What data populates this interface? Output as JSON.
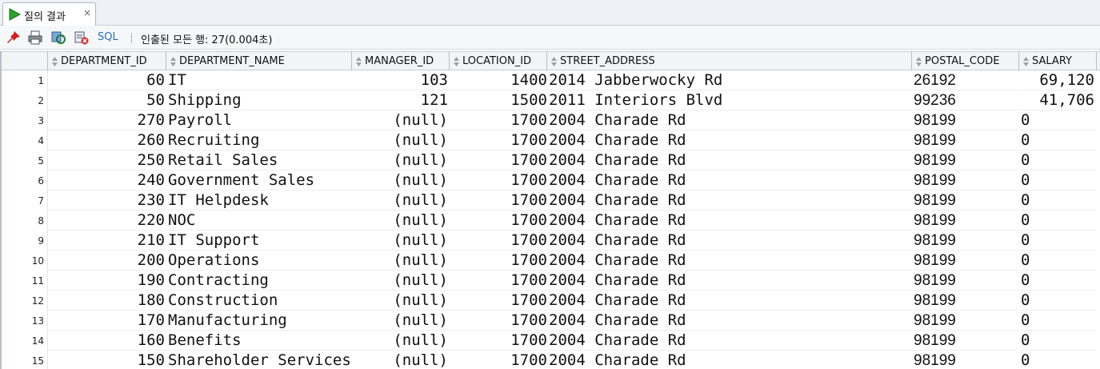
{
  "tab": {
    "title": "질의 결과",
    "close": "×"
  },
  "toolbar": {
    "icons": [
      "pin-icon",
      "print-icon",
      "refresh-icon",
      "cancel-query-icon"
    ],
    "sql_label": "SQL",
    "status": "인출된 모든 행: 27(0.004초)"
  },
  "columns": [
    "DEPARTMENT_ID",
    "DEPARTMENT_NAME",
    "MANAGER_ID",
    "LOCATION_ID",
    "STREET_ADDRESS",
    "POSTAL_CODE",
    "SALARY"
  ],
  "rows": [
    {
      "n": "1",
      "department_id": "60",
      "department_name": "IT",
      "manager_id": "103",
      "location_id": "1400",
      "street_address": "2014 Jabberwocky Rd",
      "postal_code": "26192",
      "salary": "69,120"
    },
    {
      "n": "2",
      "department_id": "50",
      "department_name": "Shipping",
      "manager_id": "121",
      "location_id": "1500",
      "street_address": "2011 Interiors Blvd",
      "postal_code": "99236",
      "salary": "41,706"
    },
    {
      "n": "3",
      "department_id": "270",
      "department_name": "Payroll",
      "manager_id": "(null)",
      "location_id": "1700",
      "street_address": "2004 Charade Rd",
      "postal_code": "98199",
      "salary": "0"
    },
    {
      "n": "4",
      "department_id": "260",
      "department_name": "Recruiting",
      "manager_id": "(null)",
      "location_id": "1700",
      "street_address": "2004 Charade Rd",
      "postal_code": "98199",
      "salary": "0"
    },
    {
      "n": "5",
      "department_id": "250",
      "department_name": "Retail Sales",
      "manager_id": "(null)",
      "location_id": "1700",
      "street_address": "2004 Charade Rd",
      "postal_code": "98199",
      "salary": "0"
    },
    {
      "n": "6",
      "department_id": "240",
      "department_name": "Government Sales",
      "manager_id": "(null)",
      "location_id": "1700",
      "street_address": "2004 Charade Rd",
      "postal_code": "98199",
      "salary": "0"
    },
    {
      "n": "7",
      "department_id": "230",
      "department_name": "IT Helpdesk",
      "manager_id": "(null)",
      "location_id": "1700",
      "street_address": "2004 Charade Rd",
      "postal_code": "98199",
      "salary": "0"
    },
    {
      "n": "8",
      "department_id": "220",
      "department_name": "NOC",
      "manager_id": "(null)",
      "location_id": "1700",
      "street_address": "2004 Charade Rd",
      "postal_code": "98199",
      "salary": "0"
    },
    {
      "n": "9",
      "department_id": "210",
      "department_name": "IT Support",
      "manager_id": "(null)",
      "location_id": "1700",
      "street_address": "2004 Charade Rd",
      "postal_code": "98199",
      "salary": "0"
    },
    {
      "n": "10",
      "department_id": "200",
      "department_name": "Operations",
      "manager_id": "(null)",
      "location_id": "1700",
      "street_address": "2004 Charade Rd",
      "postal_code": "98199",
      "salary": "0"
    },
    {
      "n": "11",
      "department_id": "190",
      "department_name": "Contracting",
      "manager_id": "(null)",
      "location_id": "1700",
      "street_address": "2004 Charade Rd",
      "postal_code": "98199",
      "salary": "0"
    },
    {
      "n": "12",
      "department_id": "180",
      "department_name": "Construction",
      "manager_id": "(null)",
      "location_id": "1700",
      "street_address": "2004 Charade Rd",
      "postal_code": "98199",
      "salary": "0"
    },
    {
      "n": "13",
      "department_id": "170",
      "department_name": "Manufacturing",
      "manager_id": "(null)",
      "location_id": "1700",
      "street_address": "2004 Charade Rd",
      "postal_code": "98199",
      "salary": "0"
    },
    {
      "n": "14",
      "department_id": "160",
      "department_name": "Benefits",
      "manager_id": "(null)",
      "location_id": "1700",
      "street_address": "2004 Charade Rd",
      "postal_code": "98199",
      "salary": "0"
    },
    {
      "n": "15",
      "department_id": "150",
      "department_name": "Shareholder Services",
      "manager_id": "(null)",
      "location_id": "1700",
      "street_address": "2004 Charade Rd",
      "postal_code": "98199",
      "salary": "0"
    }
  ]
}
